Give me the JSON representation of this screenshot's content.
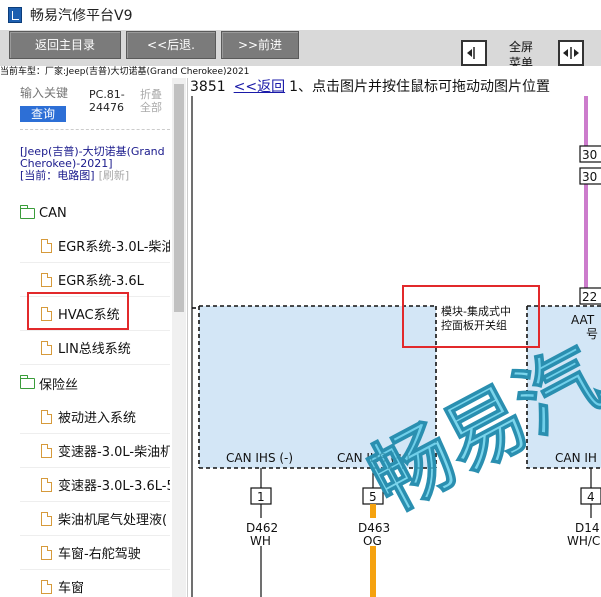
{
  "app": {
    "title": "畅易汽修平台V9"
  },
  "toolbar": {
    "home_label": "返回主目录",
    "back_label": "<<后退.",
    "forward_label": ">>前进",
    "fullscreen_label": "全屏菜单"
  },
  "vehicle_line": "当前车型：厂家:Jeep(吉普)大切诺基(Grand Cherokee)2021",
  "left_panel": {
    "search_placeholder": "输入关键",
    "search_button": "查询",
    "pc_code": "PC.81-24476",
    "collapse_all": "折叠全部",
    "vehicle_name": "[Jeep(吉普)-大切诺基(Grand Cherokee)-2021]",
    "current_label": "[当前：电路图]",
    "refresh_label": "[刷新]",
    "categories": [
      {
        "label": "CAN",
        "items": [
          "EGR系统-3.0L-柴油",
          "EGR系统-3.6L",
          "HVAC系统",
          "LIN总线系统"
        ]
      },
      {
        "label": "保险丝",
        "items": [
          "被动进入系统",
          "变速器-3.0L-柴油机",
          "变速器-3.0L-3.6L-5",
          "柴油机尾气处理液(",
          "车窗-右舵驾驶",
          "车窗"
        ]
      }
    ]
  },
  "main": {
    "doc_code": "3851",
    "back_link": "<<返回",
    "instruction": "1、点击图片并按住鼠标可拖动动图片位置"
  },
  "diagram": {
    "module_label_line1": "模块-集成式中",
    "module_label_line2": "控面板开关组",
    "pin_left_label": "CAN IHS (-)",
    "pin_mid_label": "CAN IHS (+)",
    "pin_right_label": "CAN IH",
    "pin_left_number": "1",
    "pin_mid_number": "5",
    "pin_right_number": "4",
    "wire_left_code": "D462",
    "wire_left_color": "WH",
    "wire_mid_code": "D463",
    "wire_mid_color": "OG",
    "wire_right_code": "D14",
    "wire_right_color": "WH/C",
    "top_box1": "30",
    "top_box2": "30",
    "top_box3": "22",
    "aa_label": "AAT",
    "hao_label": "号",
    "watermark": "畅易汽",
    "colors": {
      "orange_wire": "#f5a20f",
      "purple_wire": "#cc7ccc",
      "module_fill": "#d3e6f6",
      "highlight": "#e2292b",
      "watermark": "#4fc7e6"
    }
  }
}
